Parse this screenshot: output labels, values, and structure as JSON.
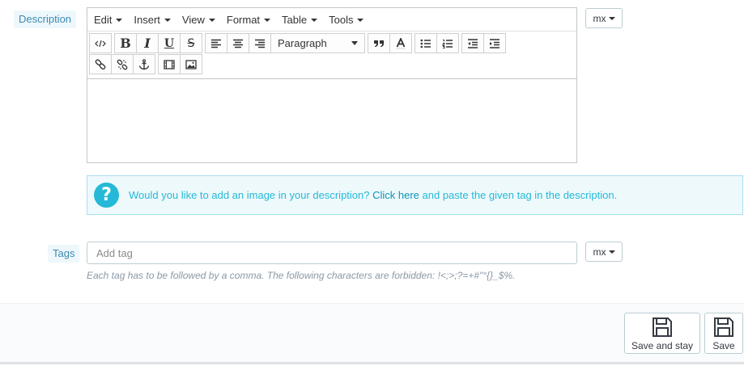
{
  "labels": {
    "description": "Description",
    "tags": "Tags"
  },
  "editor": {
    "menu": [
      "Edit",
      "Insert",
      "View",
      "Format",
      "Table",
      "Tools"
    ],
    "format_select": "Paragraph"
  },
  "lang": {
    "description": "mx",
    "tags": "mx"
  },
  "help": {
    "text_before": "Would you like to add an image in your description? ",
    "link": "Click here",
    "text_after": " and paste the given tag in the description."
  },
  "tags": {
    "placeholder": "Add tag",
    "hint": "Each tag has to be followed by a comma. The following characters are forbidden: !<;>;?=+#\"°{}_$%."
  },
  "footer": {
    "save_and_stay": "Save and stay",
    "save": "Save"
  },
  "colors": {
    "accent": "#25b9d7",
    "label_text": "#3d8ab1",
    "label_bg": "#eef8fc"
  }
}
